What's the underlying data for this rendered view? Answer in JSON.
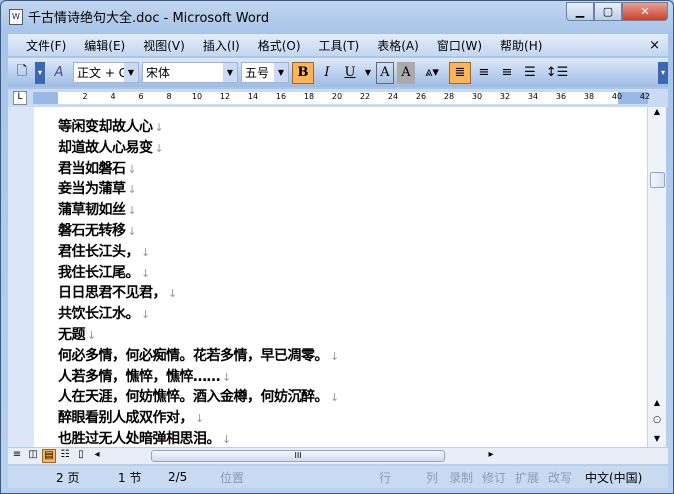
{
  "window": {
    "title": "千古情诗绝句大全.doc - Microsoft Word",
    "min": "▁",
    "max": "▢",
    "close": "✕"
  },
  "menu": [
    "文件(F)",
    "编辑(E)",
    "视图(V)",
    "插入(I)",
    "格式(O)",
    "工具(T)",
    "表格(A)",
    "窗口(W)",
    "帮助(H)"
  ],
  "menu_close": "×",
  "toolbar": {
    "style": "正文 + Ge",
    "font": "宋体",
    "size": "五号",
    "bold": "B",
    "italic": "I",
    "underline": "U",
    "charborder": "A",
    "charshade": "A"
  },
  "ruler": [
    "2",
    "4",
    "6",
    "8",
    "10",
    "12",
    "14",
    "16",
    "18",
    "20",
    "22",
    "24",
    "26",
    "28",
    "30",
    "32",
    "34",
    "36",
    "38",
    "40",
    "42"
  ],
  "document": {
    "lines": [
      "等闲变却故人心",
      "却道故人心易变",
      "君当如磐石",
      "妾当为蒲草",
      "蒲草韧如丝",
      "磐石无转移",
      "君住长江头，",
      "我住长江尾。",
      "日日思君不见君，",
      "共饮长江水。",
      "无题",
      "何必多情，何必痴情。花若多情，早已凋零。",
      "人若多情，憔悴，憔悴……",
      "人在天涯，何妨憔悴。酒入金樽，何妨沉醉。",
      "醉眼看别人成双作对，",
      "也胜过无人处暗弹相思泪。"
    ],
    "para_mark": "↓"
  },
  "status": {
    "page": "2 页",
    "section": "1 节",
    "pages": "2/5",
    "position": "位置",
    "line": "行",
    "col": "列",
    "rec": "录制",
    "trk": "修订",
    "ext": "扩展",
    "ovr": "改写",
    "lang": "中文(中国)"
  }
}
